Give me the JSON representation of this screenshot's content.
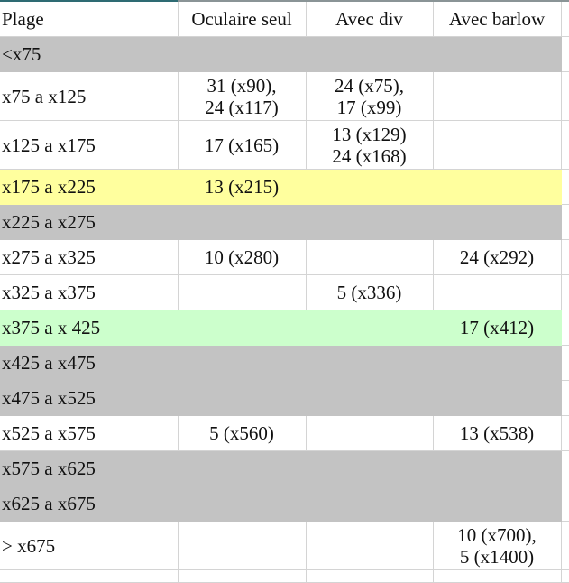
{
  "sheet": {
    "columns": [
      "Plage",
      "Oculaire seul",
      "Avec div",
      "Avec barlow"
    ],
    "rows": [
      {
        "range": "<x75",
        "highlight": "gray",
        "oculaire_seul": "",
        "avec_div": "",
        "avec_barlow": ""
      },
      {
        "range": "x75 a x125",
        "highlight": "none",
        "oculaire_seul": "31 (x90),\n24 (x117)",
        "avec_div": "24 (x75),\n17 (x99)",
        "avec_barlow": ""
      },
      {
        "range": "x125 a x175",
        "highlight": "none",
        "oculaire_seul": "17 (x165)",
        "avec_div": "13 (x129)\n24 (x168)",
        "avec_barlow": ""
      },
      {
        "range": "x175 a x225",
        "highlight": "yellow",
        "oculaire_seul": "13 (x215)",
        "avec_div": "",
        "avec_barlow": ""
      },
      {
        "range": "x225 a x275",
        "highlight": "gray",
        "oculaire_seul": "",
        "avec_div": "",
        "avec_barlow": ""
      },
      {
        "range": "x275 a x325",
        "highlight": "none",
        "oculaire_seul": "10 (x280)",
        "avec_div": "",
        "avec_barlow": "24 (x292)"
      },
      {
        "range": "x325 a x375",
        "highlight": "none",
        "oculaire_seul": "",
        "avec_div": "5 (x336)",
        "avec_barlow": ""
      },
      {
        "range": "x375 a x 425",
        "highlight": "green",
        "oculaire_seul": "",
        "avec_div": "",
        "avec_barlow": "17 (x412)"
      },
      {
        "range": "x425 a x475",
        "highlight": "gray",
        "oculaire_seul": "",
        "avec_div": "",
        "avec_barlow": ""
      },
      {
        "range": "x475 a x525",
        "highlight": "gray",
        "oculaire_seul": "",
        "avec_div": "",
        "avec_barlow": ""
      },
      {
        "range": "x525 a x575",
        "highlight": "none",
        "oculaire_seul": "5 (x560)",
        "avec_div": "",
        "avec_barlow": "13 (x538)"
      },
      {
        "range": "x575 a x625",
        "highlight": "gray",
        "oculaire_seul": "",
        "avec_div": "",
        "avec_barlow": ""
      },
      {
        "range": "x625 a x675",
        "highlight": "gray",
        "oculaire_seul": "",
        "avec_div": "",
        "avec_barlow": ""
      },
      {
        "range": "> x675",
        "highlight": "none",
        "oculaire_seul": "",
        "avec_div": "",
        "avec_barlow": "10 (x700),\n5 (x1400)"
      }
    ]
  },
  "colors": {
    "gray": "#c3c3c3",
    "yellow": "#ffff9e",
    "green": "#ccffcc",
    "gridline": "#d4d4d4"
  }
}
